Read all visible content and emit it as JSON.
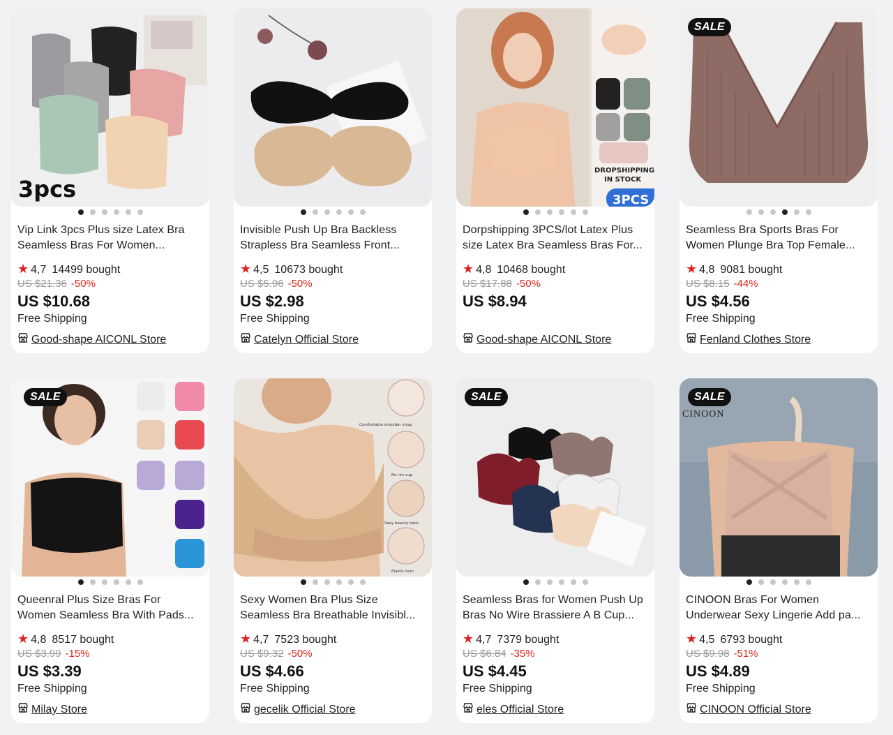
{
  "products": [
    {
      "title_l1": "Vip Link 3pcs Plus size Latex Bra",
      "title_l2": "Seamless Bras For Women...",
      "rating": "4,7",
      "sold": "14499 bought",
      "original_price": "US $21.36",
      "discount": "-50%",
      "price": "US $10.68",
      "shipping": "Free Shipping",
      "store": "Good-shape AICONL Store",
      "image_text": "3pcs",
      "sale_badge": "",
      "active_dot": 0
    },
    {
      "title_l1": "Invisible Push Up Bra Backless",
      "title_l2": "Strapless Bra Seamless Front...",
      "rating": "4,5",
      "sold": "10673 bought",
      "original_price": "US $5.96",
      "discount": "-50%",
      "price": "US $2.98",
      "shipping": "Free Shipping",
      "store": "Catelyn Official Store",
      "sale_badge": "",
      "active_dot": 0
    },
    {
      "title_l1": "Dorpshipping 3PCS/lot Latex Plus",
      "title_l2": "size Latex Bra Seamless Bras For...",
      "rating": "4,8",
      "sold": "10468 bought",
      "original_price": "US $17.88",
      "discount": "-50%",
      "price": "US $8.94",
      "shipping": "",
      "store": "Good-shape AICONL Store",
      "image_text": "DROPSHIPPING",
      "image_text2": "IN STOCK",
      "image_text3": "3PCS",
      "sale_badge": "",
      "active_dot": 0
    },
    {
      "title_l1": "Seamless Bra Sports Bras For",
      "title_l2": "Women Plunge Bra Top Female...",
      "rating": "4,8",
      "sold": "9081 bought",
      "original_price": "US $8.15",
      "discount": "-44%",
      "price": "US $4.56",
      "shipping": "Free Shipping",
      "store": "Fenland Clothes Store",
      "sale_badge": "SALE",
      "active_dot": 3
    },
    {
      "title_l1": "Queenral Plus Size Bras For",
      "title_l2": "Women Seamless Bra With Pads...",
      "rating": "4,8",
      "sold": "8517 bought",
      "original_price": "US $3.99",
      "discount": "-15%",
      "price": "US $3.39",
      "shipping": "Free Shipping",
      "store": "Milay Store",
      "sale_badge": "SALE",
      "active_dot": 0
    },
    {
      "title_l1": "Sexy Women Bra Plus Size",
      "title_l2": "Seamless Bra Breathable Invisibl...",
      "rating": "4,7",
      "sold": "7523 bought",
      "original_price": "US $9.32",
      "discount": "-50%",
      "price": "US $4.66",
      "shipping": "Free Shipping",
      "store": "gecelik Official Store",
      "image_text": "Comfortable shoulder strap",
      "image_text2": "No rim cup",
      "image_text3": "Sexy beauty back",
      "image_text4": "Elastic hem",
      "sale_badge": "",
      "active_dot": 0
    },
    {
      "title_l1": "Seamless Bras for Women Push Up",
      "title_l2": "Bras No Wire Brassiere A B Cup...",
      "rating": "4,7",
      "sold": "7379 bought",
      "original_price": "US $6.84",
      "discount": "-35%",
      "price": "US $4.45",
      "shipping": "Free Shipping",
      "store": "eles Official Store",
      "sale_badge": "SALE",
      "active_dot": 0
    },
    {
      "title_l1": "CINOON Bras For Women",
      "title_l2": "Underwear Sexy Lingerie Add pa...",
      "rating": "4,5",
      "sold": "6793 bought",
      "original_price": "US $9.98",
      "discount": "-51%",
      "price": "US $4.89",
      "shipping": "Free Shipping",
      "store": "CINOON Official Store",
      "image_text": "CINOON",
      "sale_badge": "SALE",
      "active_dot": 0
    }
  ],
  "colors": {
    "star": "#e02020",
    "discount": "#e0261b",
    "badge_bg": "#111111",
    "page_bg": "#f2f2f4"
  },
  "icons": {
    "rating": "star-icon",
    "store": "store-icon"
  }
}
